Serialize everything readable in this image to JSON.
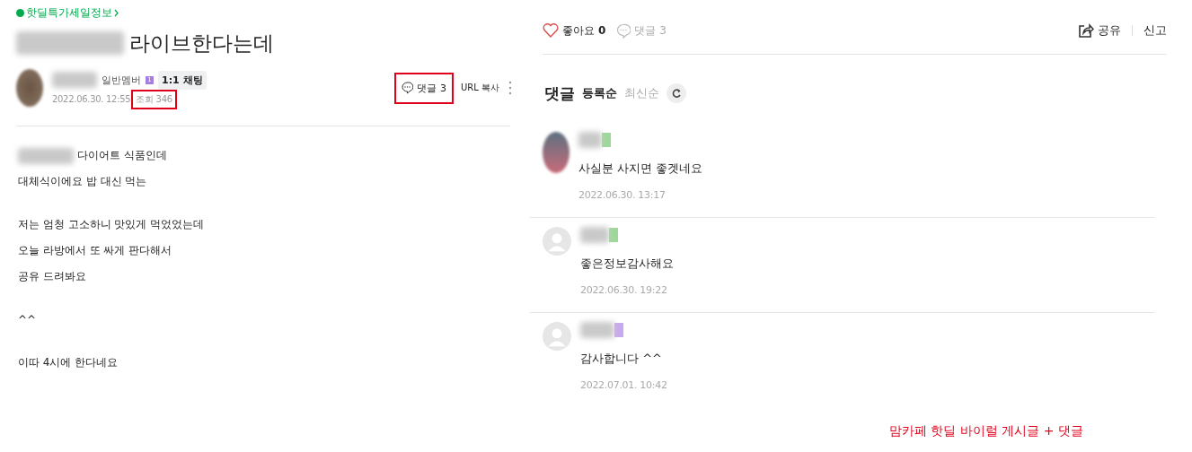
{
  "post": {
    "category": "핫딜특가세일정보",
    "title": "라이브한다는데",
    "author": {
      "avatar": {
        "kind": "photo"
      },
      "rank": "일반멤버",
      "level": "1",
      "chat": "1:1 채팅",
      "date": "2022.06.30. 12:55",
      "views": "조회 346",
      "views_highlighted": true
    },
    "comment_button": {
      "label": "댓글 3",
      "highlighted": true
    },
    "url_copy": "URL 복사",
    "paragraphs": [
      [
        {
          "text": "다이어트 식품인데",
          "redacted_prefix": true
        },
        {
          "text": "대체식이에요 밥 대신 먹는",
          "redacted_prefix": false
        }
      ],
      [
        {
          "text": "저는 엄청 고소하니 맛있게 먹었었는데",
          "redacted_prefix": false
        },
        {
          "text": "오늘 라방에서 또 싸게 판다해서",
          "redacted_prefix": false
        },
        {
          "text": "공유 드려봐요",
          "redacted_prefix": false
        }
      ],
      [
        {
          "text": "^^",
          "redacted_prefix": false
        }
      ],
      [
        {
          "text": "이따 4시에 한다네요",
          "redacted_prefix": false
        }
      ]
    ]
  },
  "actions": {
    "like": {
      "label": "좋아요",
      "count": "0",
      "liked": false
    },
    "comments": {
      "label": "댓글 3"
    },
    "share": "공유",
    "report": "신고"
  },
  "comments_section": {
    "title": "댓글",
    "sort": [
      {
        "label": "등록순",
        "selected": true
      },
      {
        "label": "최신순",
        "selected": false
      }
    ],
    "comments": [
      {
        "avatar": {
          "kind": "photo"
        },
        "color": "#9fd89a",
        "text": "사실분 사지면 좋겟네요",
        "date": "2022.06.30. 13:17"
      },
      {
        "avatar": {
          "kind": "default"
        },
        "color": "#9fd89a",
        "text": "좋은정보감사해요",
        "date": "2022.06.30. 19:22"
      },
      {
        "avatar": {
          "kind": "default"
        },
        "color": "#c9a8f0",
        "text": "감사합니다 ^^",
        "date": "2022.07.01. 10:42"
      }
    ]
  },
  "caption": "맘카페 핫딜 바이럴 게시글 + 댓글"
}
